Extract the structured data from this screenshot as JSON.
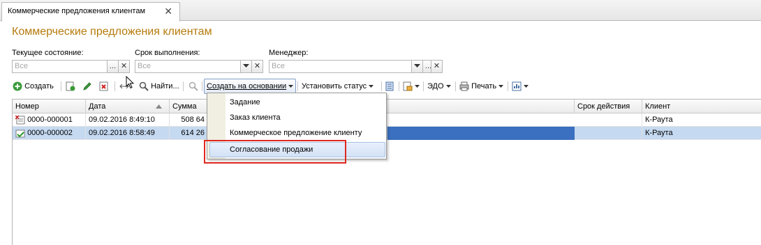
{
  "tab": {
    "label": "Коммерческие предложения клиентам",
    "close": "✕"
  },
  "page_title": "Коммерческие предложения клиентам",
  "filters": {
    "state": {
      "label": "Текущее состояние:",
      "placeholder": "Все"
    },
    "deadline": {
      "label": "Срок выполнения:",
      "placeholder": "Все"
    },
    "manager": {
      "label": "Менеджер:",
      "placeholder": "Все"
    },
    "select_btn": "...",
    "clear_btn": "✕"
  },
  "toolbar": {
    "create": "Создать",
    "find": "Найти...",
    "create_based_on": "Создать на основании",
    "set_status": "Установить статус",
    "edo": "ЭДО",
    "print": "Печать"
  },
  "table": {
    "columns": [
      "Номер",
      "Дата",
      "Сумма",
      "Срок действия",
      "Клиент"
    ],
    "rows": [
      {
        "number": "0000-000001",
        "date": "09.02.2016 8:49:10",
        "sum": "508 64",
        "valid": "",
        "client": "К-Раута"
      },
      {
        "number": "0000-000002",
        "date": "09.02.2016 8:58:49",
        "sum": "614 26",
        "valid": "",
        "client": "К-Раута"
      }
    ]
  },
  "menu": {
    "items": [
      "Задание",
      "Заказ клиента",
      "Коммерческое предложение клиенту",
      "Согласование продажи"
    ]
  },
  "colors": {
    "title": "#b57a0b",
    "selection": "#c5d9f1",
    "highlight_box": "#e0271f"
  }
}
